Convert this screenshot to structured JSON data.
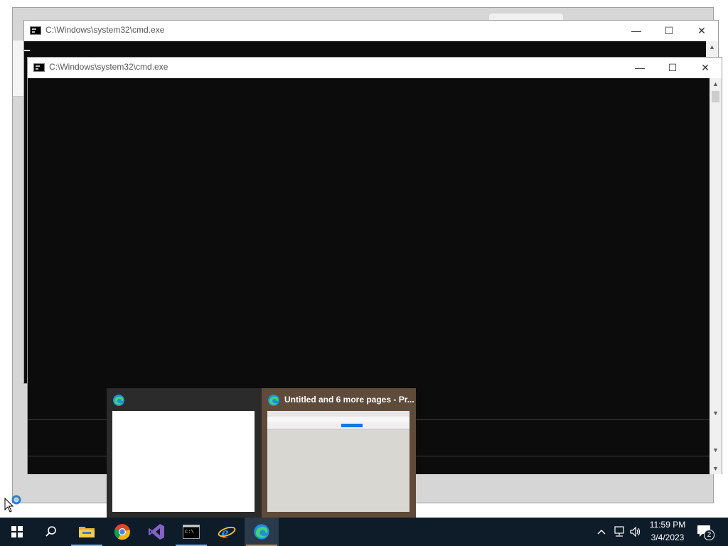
{
  "windows": {
    "cmd_back": {
      "title": "C:\\Windows\\system32\\cmd.exe",
      "minimize": "—",
      "maximize": "☐",
      "close": "✕"
    },
    "cmd_front": {
      "title": "C:\\Windows\\system32\\cmd.exe",
      "minimize": "—",
      "maximize": "☐",
      "close": "✕"
    }
  },
  "thumbnails": [
    {
      "title": "",
      "app_icon": "edge-icon"
    },
    {
      "title": "Untitled and 6 more pages - Pr...",
      "app_icon": "edge-icon"
    }
  ],
  "taskbar": {
    "items": [
      {
        "name": "start-button",
        "icon": "windows-logo-icon"
      },
      {
        "name": "search-button",
        "icon": "search-icon"
      },
      {
        "name": "file-explorer",
        "icon": "folder-icon"
      },
      {
        "name": "chrome",
        "icon": "chrome-icon"
      },
      {
        "name": "visual-studio",
        "icon": "visual-studio-icon"
      },
      {
        "name": "command-prompt",
        "icon": "cmd-icon"
      },
      {
        "name": "internet-explorer",
        "icon": "ie-icon"
      },
      {
        "name": "edge",
        "icon": "edge-icon"
      }
    ],
    "clock": {
      "time": "11:59 PM",
      "date": "3/4/2023"
    },
    "notifications_count": "2",
    "colors": {
      "background": "#0e1c2a",
      "active_underline": "#d08030",
      "running_underline": "#76b9ed"
    }
  }
}
